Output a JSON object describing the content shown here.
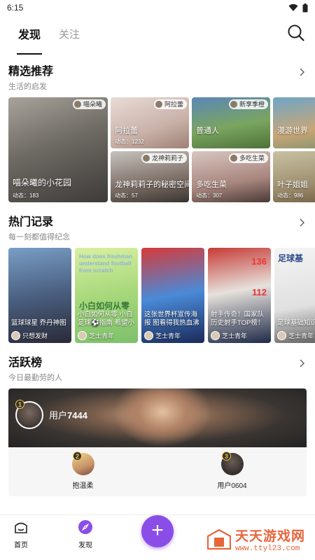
{
  "status_bar": {
    "time": "6:15"
  },
  "top_tabs": [
    {
      "label": "发现"
    },
    {
      "label": "关注"
    }
  ],
  "featured": {
    "title": "精选推荐",
    "subtitle": "生活的启发",
    "big": {
      "author": "喵朵曦",
      "caption": "喵朵曦的小花园",
      "meta": "动态：183"
    },
    "items": [
      {
        "author": "阿拉蕾",
        "caption": "阿拉蕾",
        "meta": "动态：1232"
      },
      {
        "author": "龙神莉莉子",
        "caption": "龙神莉莉子的秘密空间",
        "meta": "动态：57"
      },
      {
        "author": "新享季橙",
        "caption": "普通人",
        "meta": ""
      },
      {
        "author": "多吃生菜",
        "caption": "多吃生菜",
        "meta": "动态：307"
      },
      {
        "author": "",
        "caption": "漫游世界",
        "meta": ""
      },
      {
        "author": "",
        "caption": "叶子姐姐",
        "meta": "动态：986"
      }
    ]
  },
  "hot": {
    "title": "热门记录",
    "subtitle": "每一刻都值得纪念",
    "items": [
      {
        "title": "篮球球星 乔丹神图",
        "author": "只想发财"
      },
      {
        "title": "小白如何从零 小白足球⚽指南 希望小白也可以懂…",
        "author": "芝士青年",
        "overlay": "How does freshman understand football from scratch",
        "big": "小白如何从零"
      },
      {
        "title": "这张世界杯宣传海报 图看得我热血沸腾",
        "author": "芝士青年"
      },
      {
        "title": "射手传奇！国家队历史射手TOP榜！",
        "author": "芝士青年",
        "n1": "136",
        "n2": "112"
      },
      {
        "title": "足球基础知识 快手",
        "author": "芝士青年",
        "head": "足球基"
      }
    ]
  },
  "active": {
    "title": "活跃榜",
    "subtitle": "今日最勤劳的人",
    "first": {
      "rank": "1",
      "name_prefix": "用户",
      "name_num": "7444"
    },
    "second": {
      "rank": "2",
      "name": "抱温柔"
    },
    "third": {
      "rank": "3",
      "name": "用户0604"
    }
  },
  "bottom_nav": {
    "home": "首页",
    "discover": "发现",
    "add": "+"
  },
  "watermark": {
    "brand": "天天游戏网",
    "url": "www.ttyl23.com"
  }
}
